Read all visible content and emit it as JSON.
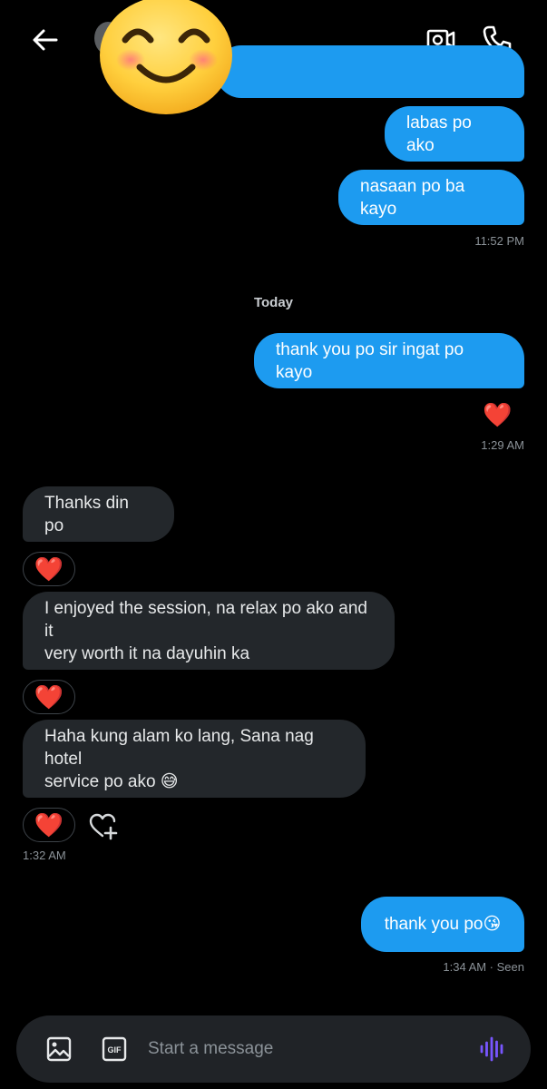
{
  "header": {
    "back_icon": "arrow-left-icon",
    "video_icon": "video-camera-icon",
    "call_icon": "phone-icon",
    "sticker_icon": "smiling-face-emoji"
  },
  "messages": [
    {
      "id": "m0",
      "direction": "outgoing",
      "text": ""
    },
    {
      "id": "m1",
      "direction": "outgoing",
      "text": "labas po ako"
    },
    {
      "id": "m2",
      "direction": "outgoing",
      "text": "nasaan po ba kayo"
    },
    {
      "id": "m3",
      "direction": "outgoing",
      "text": "thank you po sir ingat po kayo"
    },
    {
      "id": "m4",
      "direction": "incoming",
      "text": "Thanks din po"
    },
    {
      "id": "m5",
      "direction": "incoming",
      "line1": "I enjoyed the session, na relax po ako and it",
      "line2": "very worth it na dayuhin ka"
    },
    {
      "id": "m6",
      "direction": "incoming",
      "line1": "Haha kung alam ko lang, Sana nag hotel",
      "line2": "service po ako 😅"
    },
    {
      "id": "m7",
      "direction": "outgoing",
      "text": "thank you po😘"
    }
  ],
  "timestamps": {
    "t1": "11:52 PM",
    "t2": "1:29 AM",
    "t3": "1:32 AM",
    "t4": "1:34 AM · Seen"
  },
  "day_separator": "Today",
  "reactions": {
    "heart": "❤️",
    "add_reaction_icon": "heart-plus-icon"
  },
  "composer": {
    "placeholder": "Start a message",
    "image_icon": "image-icon",
    "gif_label": "GIF",
    "voice_icon": "voice-wave-icon"
  },
  "colors": {
    "background": "#000000",
    "outgoing_bubble": "#1d9bf0",
    "incoming_bubble": "#23272b",
    "accent_voice": "#7856ff",
    "heart": "#e01e2b"
  }
}
